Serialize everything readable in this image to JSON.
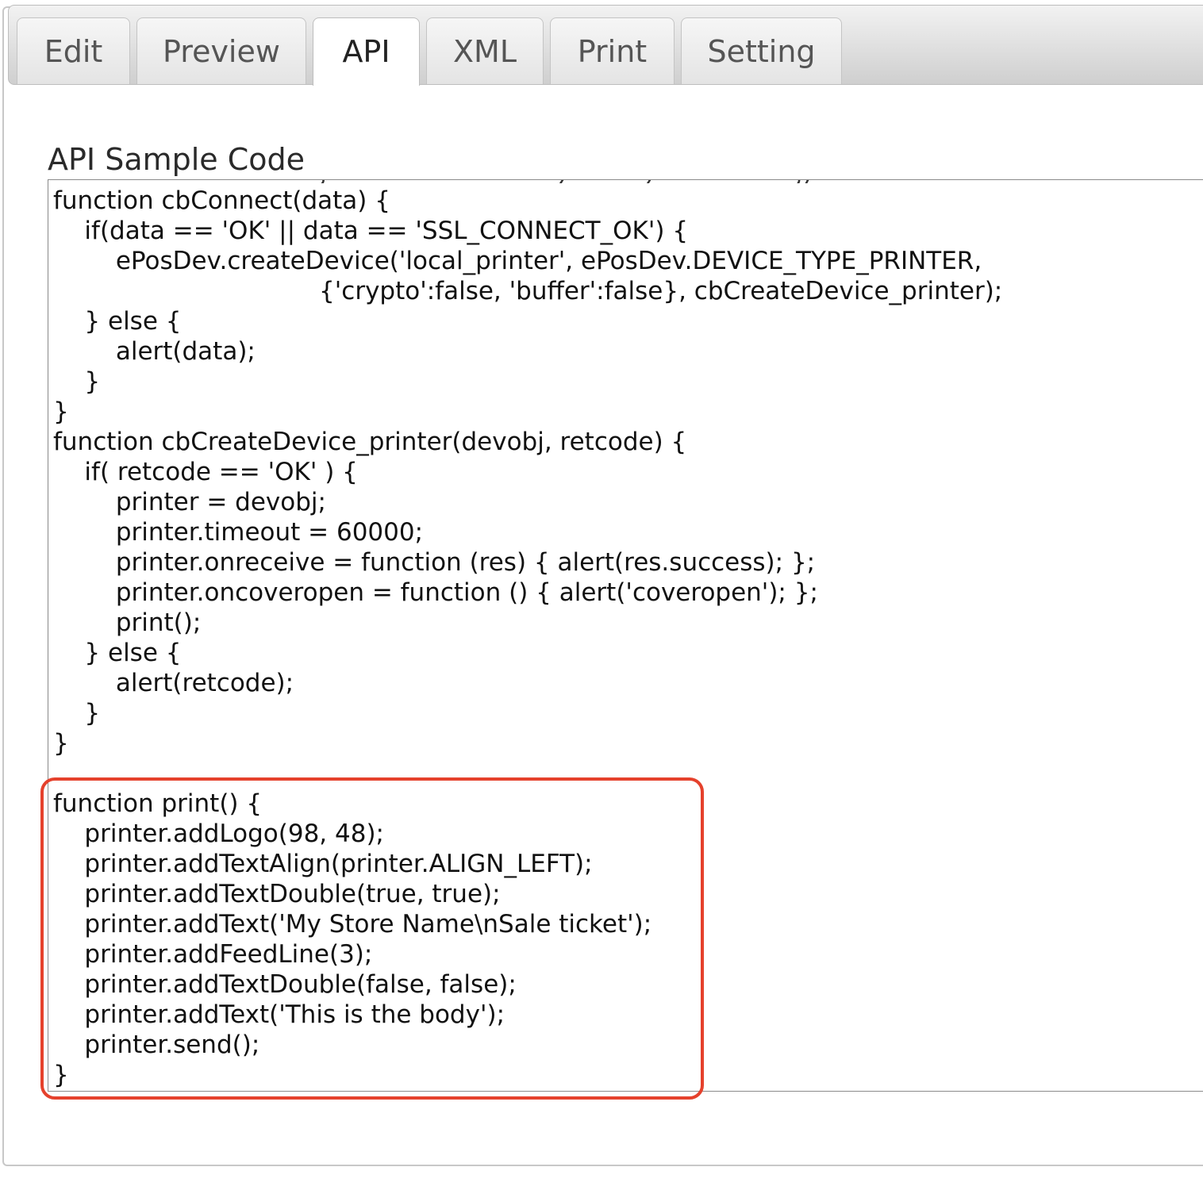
{
  "tabs": [
    {
      "label": "Edit"
    },
    {
      "label": "Preview"
    },
    {
      "label": "API"
    },
    {
      "label": "XML"
    },
    {
      "label": "Print"
    },
    {
      "label": "Setting"
    }
  ],
  "active_tab": "API",
  "section_title": "API Sample Code",
  "code_lines": [
    "function cbConnect(data) {",
    "    if(data == 'OK' || data == 'SSL_CONNECT_OK') {",
    "        ePosDev.createDevice('local_printer', ePosDev.DEVICE_TYPE_PRINTER,",
    "                                  {'crypto':false, 'buffer':false}, cbCreateDevice_printer);",
    "    } else {",
    "        alert(data);",
    "    }",
    "}",
    "function cbCreateDevice_printer(devobj, retcode) {",
    "    if( retcode == 'OK' ) {",
    "        printer = devobj;",
    "        printer.timeout = 60000;",
    "        printer.onreceive = function (res) { alert(res.success); };",
    "        printer.oncoveropen = function () { alert('coveropen'); };",
    "        print();",
    "    } else {",
    "        alert(retcode);",
    "    }",
    "}",
    "",
    "function print() {",
    "    printer.addLogo(98, 48);",
    "    printer.addTextAlign(printer.ALIGN_LEFT);",
    "    printer.addTextDouble(true, true);",
    "    printer.addText('My Store Name\\nSale ticket');",
    "    printer.addFeedLine(3);",
    "    printer.addTextDouble(false, false);",
    "    printer.addText('This is the body');",
    "    printer.send();",
    "}"
  ],
  "highlight_color": "#e5412c"
}
